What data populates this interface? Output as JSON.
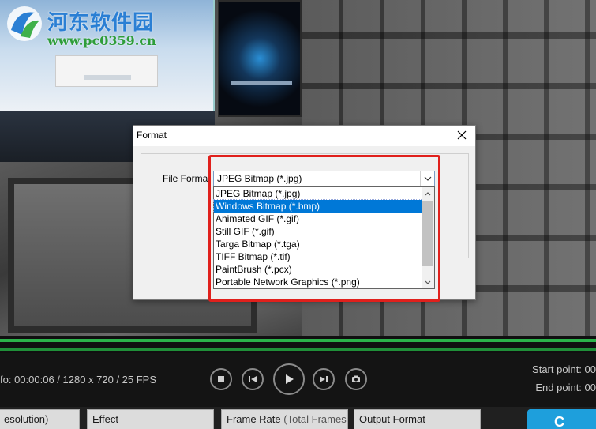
{
  "watermark": {
    "title": "河东软件园",
    "url": "www.pc0359.cn"
  },
  "player": {
    "info": "fo: 00:00:06 / 1280 x 720 / 25 FPS",
    "start_point": "Start point: 00",
    "end_point": "End point: 00"
  },
  "tabs": {
    "resolution": "esolution)",
    "effect": "Effect",
    "frame_rate": "Frame Rate",
    "frame_rate_sub": "(Total Frames)",
    "output_format": "Output Format",
    "convert": "C"
  },
  "dialog": {
    "title": "Format",
    "file_format_label": "File Format",
    "selected_value": "JPEG Bitmap (*.jpg)",
    "options": [
      "JPEG Bitmap (*.jpg)",
      "Windows Bitmap (*.bmp)",
      "Animated GIF (*.gif)",
      "Still GIF (*.gif)",
      "Targa Bitmap (*.tga)",
      "TIFF Bitmap (*.tif)",
      "PaintBrush (*.pcx)",
      "Portable Network Graphics (*.png)"
    ],
    "highlighted_option": "Windows Bitmap (*.bmp)"
  },
  "colors": {
    "highlight": "#0078d7",
    "annotation_border": "#e0201c",
    "timeline": "#2bb34a",
    "convert_button": "#1e9fdc"
  }
}
